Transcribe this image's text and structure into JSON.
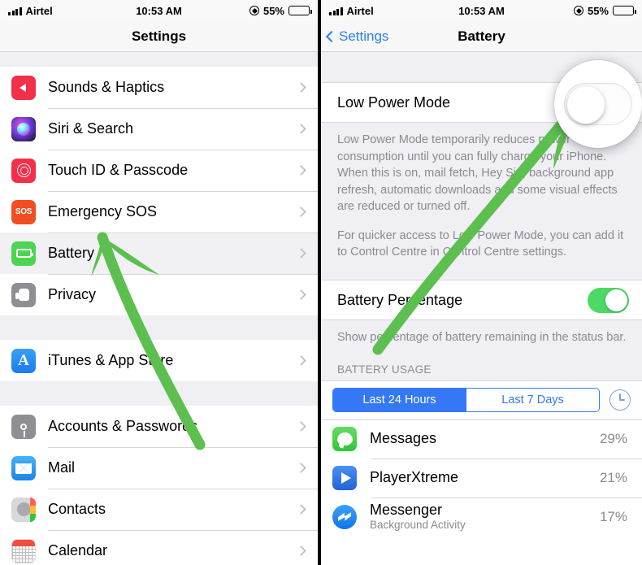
{
  "status_bar": {
    "carrier": "Airtel",
    "time": "10:53 AM",
    "battery_percent": "55%",
    "signal_icon": "signal-bars-icon",
    "location_icon": "location-arrow-icon",
    "battery_icon": "battery-icon"
  },
  "left_pane": {
    "nav_title": "Settings",
    "groups": [
      {
        "items": [
          {
            "label": "Sounds & Haptics",
            "icon": "sounds-haptics-icon",
            "selected": false
          },
          {
            "label": "Siri & Search",
            "icon": "siri-search-icon",
            "selected": false
          },
          {
            "label": "Touch ID & Passcode",
            "icon": "touch-id-icon",
            "selected": false
          },
          {
            "label": "Emergency SOS",
            "icon": "emergency-sos-icon",
            "selected": false
          },
          {
            "label": "Battery",
            "icon": "battery-settings-icon",
            "selected": true
          },
          {
            "label": "Privacy",
            "icon": "privacy-icon",
            "selected": false
          }
        ]
      },
      {
        "items": [
          {
            "label": "iTunes & App Store",
            "icon": "itunes-app-store-icon",
            "selected": false
          }
        ]
      },
      {
        "items": [
          {
            "label": "Accounts & Passwords",
            "icon": "accounts-passwords-icon",
            "selected": false
          },
          {
            "label": "Mail",
            "icon": "mail-icon",
            "selected": false
          },
          {
            "label": "Contacts",
            "icon": "contacts-icon",
            "selected": false
          },
          {
            "label": "Calendar",
            "icon": "calendar-icon",
            "selected": false
          }
        ]
      }
    ],
    "chevron_icon": "chevron-right-icon"
  },
  "right_pane": {
    "back_label": "Settings",
    "nav_title": "Battery",
    "back_icon": "chevron-left-icon",
    "low_power_mode": {
      "label": "Low Power Mode",
      "toggle_state": "off",
      "footnote_1": "Low Power Mode temporarily reduces power consumption until you can fully charge your iPhone. When this is on, mail fetch, Hey Siri, background app refresh, automatic downloads and some visual effects are reduced or turned off.",
      "footnote_2": "For quicker access to Low Power Mode, you can add it to Control Centre in Control Centre settings."
    },
    "battery_percentage": {
      "label": "Battery Percentage",
      "toggle_state": "on",
      "footnote": "Show percentage of battery remaining in the status bar."
    },
    "battery_usage": {
      "section_header": "BATTERY USAGE",
      "segments": [
        {
          "label": "Last 24 Hours",
          "active": true
        },
        {
          "label": "Last 7 Days",
          "active": false
        }
      ],
      "clock_icon": "clock-icon",
      "apps": [
        {
          "name": "Messages",
          "subtitle": "",
          "percent": "29%",
          "icon": "messages-app-icon"
        },
        {
          "name": "PlayerXtreme",
          "subtitle": "",
          "percent": "21%",
          "icon": "playerxtreme-app-icon"
        },
        {
          "name": "Messenger",
          "subtitle": "Background Activity",
          "percent": "17%",
          "icon": "messenger-app-icon"
        }
      ]
    }
  },
  "annotations": {
    "magnifier": {
      "name": "magnified-low-power-toggle",
      "toggle_state": "off"
    },
    "arrow_left": {
      "name": "green-arrow-pointing-to-battery-row",
      "color": "#5cc池"
    },
    "arrow_right": {
      "name": "green-arrow-pointing-to-low-power-toggle"
    },
    "arrow_color": "#5cbf4f"
  }
}
